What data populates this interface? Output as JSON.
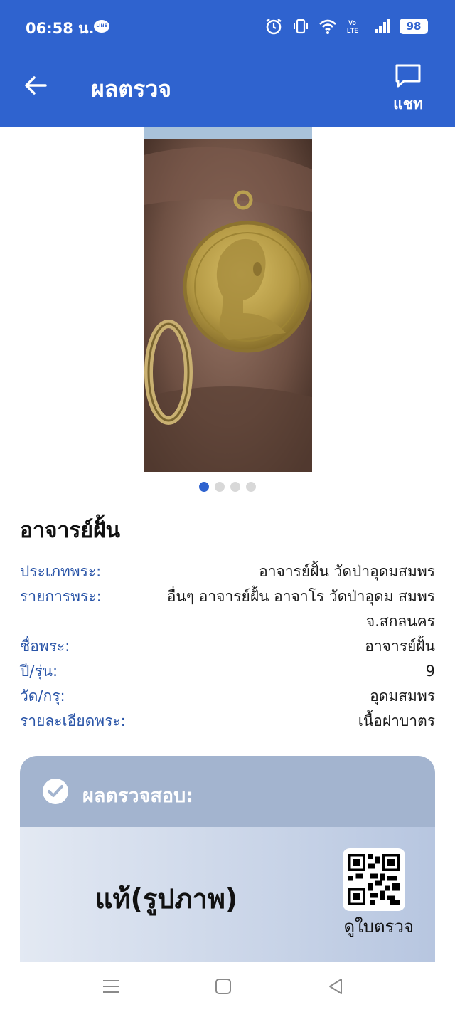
{
  "status_bar": {
    "time": "06:58 น.",
    "line_badge": "LINE",
    "battery": "98",
    "icons": [
      "alarm-icon",
      "vibrate-icon",
      "wifi-icon",
      "volte-icon",
      "signal-icon",
      "battery-icon"
    ]
  },
  "header": {
    "title": "ผลตรวจ",
    "chat_label": "แชท",
    "color": "#2f63cf"
  },
  "gallery": {
    "image_count": 4,
    "active_index": 0
  },
  "amulet": {
    "name": "อาจารย์ฝั้น",
    "details": [
      {
        "label": "ประเภทพระ:",
        "value": "อาจารย์ฝั้น วัดป่าอุดมสมพร"
      },
      {
        "label": "รายการพระ:",
        "value": "อื่นๆ อาจารย์ฝั้น อาจาโร วัดป่าอุดม สมพร จ.สกลนคร"
      },
      {
        "label": "ชื่อพระ:",
        "value": "อาจารย์ฝั้น"
      },
      {
        "label": "ปี/รุ่น:",
        "value": "9"
      },
      {
        "label": "วัด/กรุ:",
        "value": "อุดมสมพร"
      },
      {
        "label": "รายละเอียดพระ:",
        "value": "เนื้อฝาบาตร"
      }
    ]
  },
  "result_card": {
    "heading": "ผลตรวจสอบ:",
    "result": "แท้(รูปภาพ)",
    "view_certificate": "ดูใบตรวจ",
    "header_color": "#a3b4cf"
  },
  "nav_bar": {
    "icons": [
      "menu-icon",
      "home-icon",
      "back-triangle-icon"
    ]
  }
}
